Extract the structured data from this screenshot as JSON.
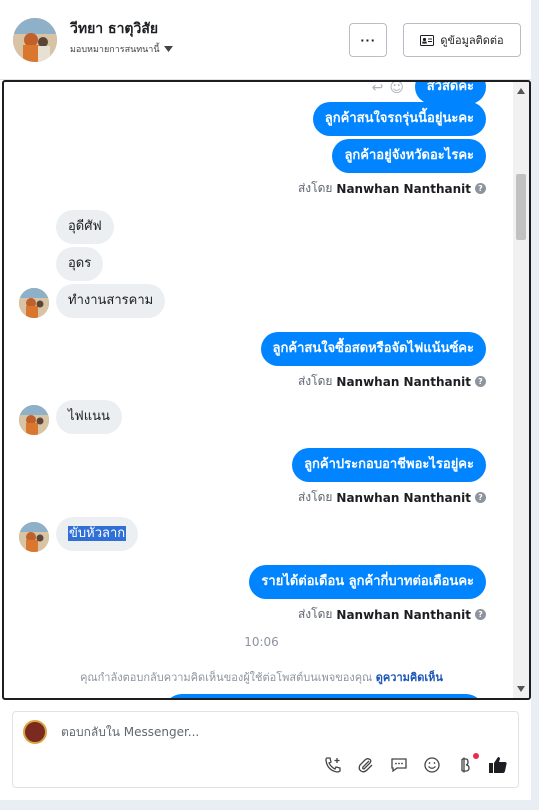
{
  "header": {
    "name": "วีทยา ธาตุวิสัย",
    "assigned": "มอบหมายการสนทนานี้",
    "more_label": "···",
    "info_label": "ดูข้อมูลติดต่อ"
  },
  "messages": {
    "top_partial": "สวัสดีค่ะ",
    "m1": "ลูกค้าสนใจรถรุ่นนี้อยู่นะคะ",
    "m2": "ลูกค้าอยู่จังหวัดอะไรคะ",
    "sent_prefix": "ส่งโดย",
    "agent": "Nanwhan Nanthanit",
    "in1": "อุดีศัฟ",
    "in2": "อุดร",
    "in3": "ทำงานสารคาม",
    "m3": "ลูกค้าสนใจซื้อสดหรือจัดไฟแน้นซ์คะ",
    "in4": "ไฟแนน",
    "m4": "ลูกค้าประกอบอาชีพอะไรอยู่คะ",
    "in5": "ขับหัวลาก",
    "m5": "รายได้ต่อเดือน ลูกค้ากี่บาทต่อเดือนคะ",
    "time": "10:06",
    "notice": "คุณกำลังตอบกลับความคิดเห็นของผู้ใช้ต่อโพสต์บนเพจของคุณ",
    "notice_link": "ดูความคิดเห็น"
  },
  "composer": {
    "placeholder": "ตอบกลับใน Messenger..."
  },
  "colors": {
    "accent": "#0084ff",
    "incoming": "#eceff2",
    "selection": "#2f6fd6"
  }
}
